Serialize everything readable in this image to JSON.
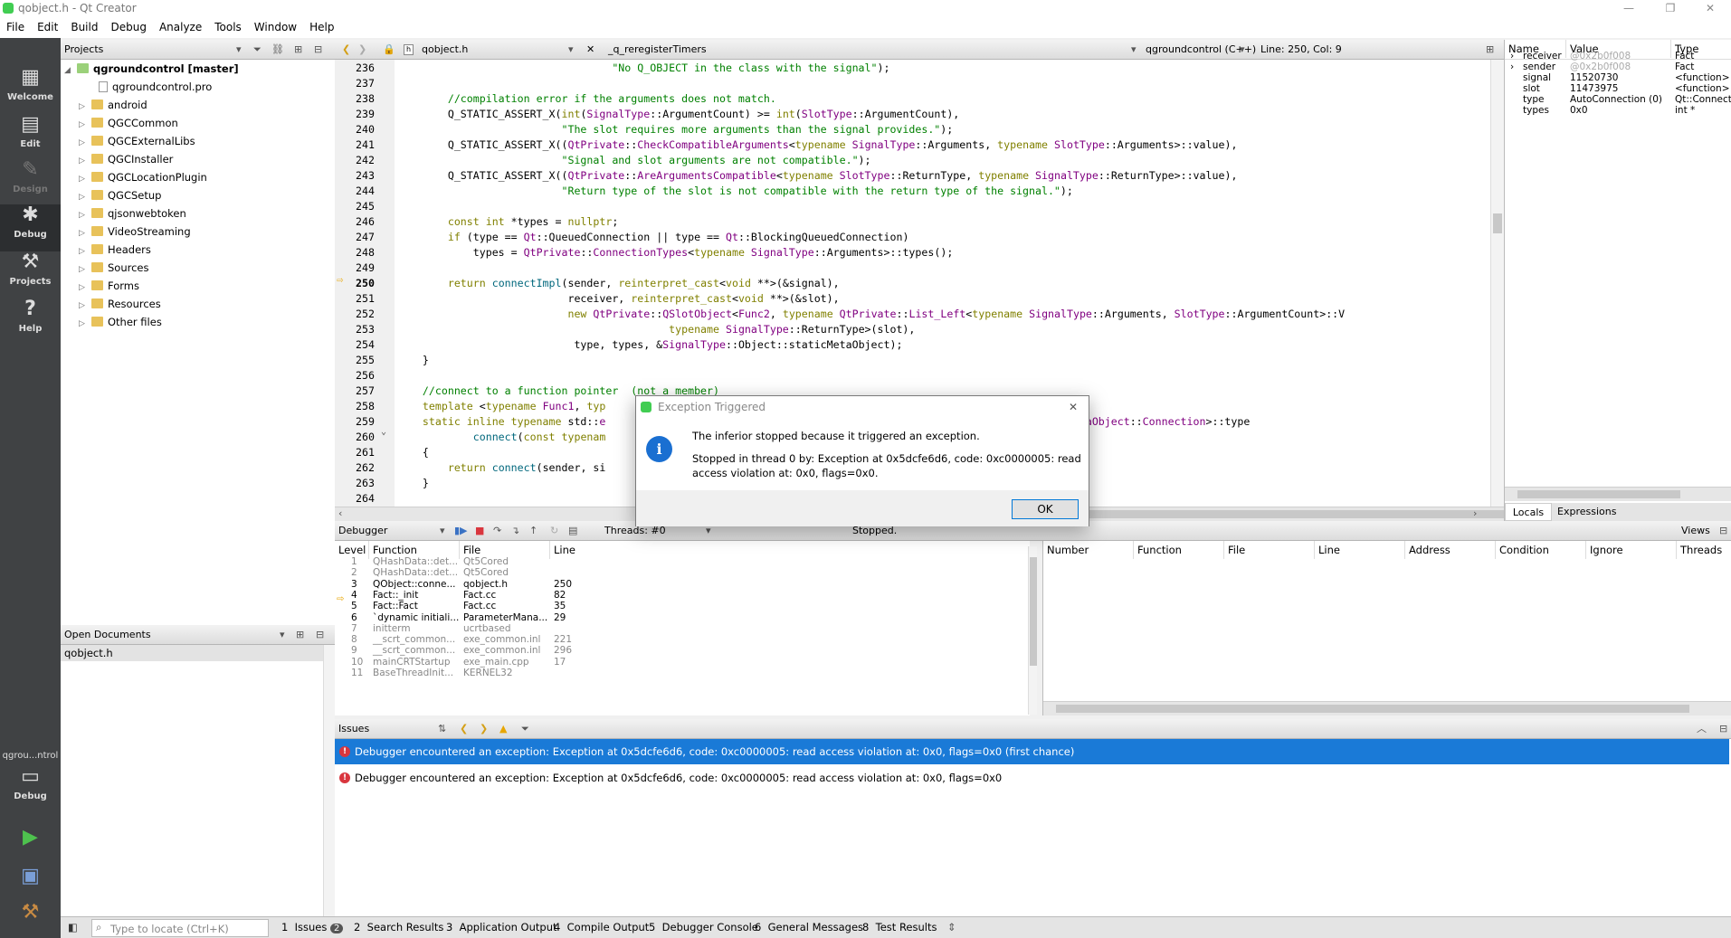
{
  "window": {
    "title": "qobject.h - Qt Creator",
    "minimize": "—",
    "restore": "❐",
    "close": "✕"
  },
  "menu": [
    "File",
    "Edit",
    "Build",
    "Debug",
    "Analyze",
    "Tools",
    "Window",
    "Help"
  ],
  "modes": [
    {
      "label": "Welcome",
      "icon": "grid-icon"
    },
    {
      "label": "Edit",
      "icon": "edit-icon"
    },
    {
      "label": "Design",
      "icon": "pen-icon"
    },
    {
      "label": "Debug",
      "icon": "bug-icon"
    },
    {
      "label": "Projects",
      "icon": "wrench-icon"
    },
    {
      "label": "Help",
      "icon": "help-icon"
    }
  ],
  "kit": {
    "label": "qgrou...ntrol",
    "mode": "Debug"
  },
  "projects": {
    "header": "Projects",
    "root": "qgroundcontrol [master]",
    "items": [
      "qgroundcontrol.pro",
      "android",
      "QGCCommon",
      "QGCExternalLibs",
      "QGCInstaller",
      "QGCLocationPlugin",
      "QGCSetup",
      "qjsonwebtoken",
      "VideoStreaming",
      "Headers",
      "Sources",
      "Forms",
      "Resources",
      "Other files"
    ]
  },
  "open_documents": {
    "header": "Open Documents",
    "items": [
      "qobject.h"
    ]
  },
  "editor_toolbar": {
    "file": "qobject.h",
    "symbol": "_q_reregisterTimers",
    "project": "qgroundcontrol (C++)",
    "position": "Line: 250, Col: 9"
  },
  "code": {
    "lines": [
      {
        "n": "236",
        "html": "                                  <span class='s'>\"No Q_OBJECT in the class with the signal\"</span>);"
      },
      {
        "n": "237",
        "html": ""
      },
      {
        "n": "238",
        "html": "        <span class='c'>//compilation error if the arguments does not match.</span>"
      },
      {
        "n": "239",
        "html": "        Q_STATIC_ASSERT_X(<span class='k'>int</span>(<span class='t'>SignalType</span>::ArgumentCount) &gt;= <span class='k'>int</span>(<span class='t'>SlotType</span>::ArgumentCount),"
      },
      {
        "n": "240",
        "html": "                          <span class='s'>\"The slot requires more arguments than the signal provides.\"</span>);"
      },
      {
        "n": "241",
        "html": "        Q_STATIC_ASSERT_X((<span class='t'>QtPrivate</span>::<span class='t'>CheckCompatibleArguments</span>&lt;<span class='k'>typename</span> <span class='t'>SignalType</span>::Arguments, <span class='k'>typename</span> <span class='t'>SlotType</span>::Arguments&gt;::value),"
      },
      {
        "n": "242",
        "html": "                          <span class='s'>\"Signal and slot arguments are not compatible.\"</span>);"
      },
      {
        "n": "243",
        "html": "        Q_STATIC_ASSERT_X((<span class='t'>QtPrivate</span>::<span class='t'>AreArgumentsCompatible</span>&lt;<span class='k'>typename</span> <span class='t'>SlotType</span>::ReturnType, <span class='k'>typename</span> <span class='t'>SignalType</span>::ReturnType&gt;::value),"
      },
      {
        "n": "244",
        "html": "                          <span class='s'>\"Return type of the slot is not compatible with the return type of the signal.\"</span>);"
      },
      {
        "n": "245",
        "html": ""
      },
      {
        "n": "246",
        "html": "        <span class='k'>const int</span> *types = <span class='k'>nullptr</span>;"
      },
      {
        "n": "247",
        "html": "        <span class='k'>if</span> (type == <span class='t'>Qt</span>::QueuedConnection || type == <span class='t'>Qt</span>::BlockingQueuedConnection)"
      },
      {
        "n": "248",
        "html": "            types = <span class='t'>QtPrivate</span>::<span class='t'>ConnectionTypes</span>&lt;<span class='k'>typename</span> <span class='t'>SignalType</span>::Arguments&gt;::types();"
      },
      {
        "n": "249",
        "html": ""
      },
      {
        "n": "250",
        "html": "        <span class='k'>return</span> <span class='f'>connectImpl</span>(sender, <span class='k'>reinterpret_cast</span>&lt;<span class='k'>void</span> **&gt;(&amp;signal),"
      },
      {
        "n": "251",
        "html": "                           receiver, <span class='k'>reinterpret_cast</span>&lt;<span class='k'>void</span> **&gt;(&amp;slot),"
      },
      {
        "n": "252",
        "html": "                           <span class='k'>new</span> <span class='t'>QtPrivate</span>::<span class='t'>QSlotObject</span>&lt;<span class='t'>Func2</span>, <span class='k'>typename</span> <span class='t'>QtPrivate</span>::<span class='t'>List_Left</span>&lt;<span class='k'>typename</span> <span class='t'>SignalType</span>::Arguments, <span class='t'>SlotType</span>::ArgumentCount&gt;::V"
      },
      {
        "n": "253",
        "html": "                                           <span class='k'>typename</span> <span class='t'>SignalType</span>::ReturnType&gt;(slot),"
      },
      {
        "n": "254",
        "html": "                            type, types, &amp;<span class='t'>SignalType</span>::Object::staticMetaObject);"
      },
      {
        "n": "255",
        "html": "    }"
      },
      {
        "n": "256",
        "html": ""
      },
      {
        "n": "257",
        "html": "    <span class='c'>//connect to a function pointer  (not a member)</span>"
      },
      {
        "n": "258",
        "html": "    <span class='k'>template</span> &lt;<span class='k'>typename</span> <span class='t'>Func1</span>, <span class='k'>typ</span>"
      },
      {
        "n": "259",
        "html": "    <span class='k'>static inline typename</span> std::<span class='t'>e</span>                                                                  &gt;= 0, <span class='t'>QMetaObject</span>::<span class='t'>Connection</span>&gt;::type"
      },
      {
        "n": "260",
        "html": "            <span class='f'>connect</span>(<span class='k'>const typenam</span>                                                            <span class='t'>nal</span>, <span class='t'>Func2</span> slot)"
      },
      {
        "n": "261",
        "html": "    {"
      },
      {
        "n": "262",
        "html": "        <span class='k'>return</span> <span class='f'>connect</span>(sender, si"
      },
      {
        "n": "263",
        "html": "    }"
      },
      {
        "n": "264",
        "html": ""
      }
    ]
  },
  "locals": {
    "headers": [
      "Name",
      "Value",
      "Type"
    ],
    "rows": [
      {
        "name": "receiver",
        "value": "@0x2b0f008",
        "type": "Fact",
        "exp": true,
        "dim": true
      },
      {
        "name": "sender",
        "value": "@0x2b0f008",
        "type": "Fact",
        "exp": true,
        "dim": true
      },
      {
        "name": "signal",
        "value": "11520730",
        "type": "<function>",
        "exp": false,
        "dim": false
      },
      {
        "name": "slot",
        "value": "11473975",
        "type": "<function>",
        "exp": false,
        "dim": false
      },
      {
        "name": "type",
        "value": "AutoConnection (0)",
        "type": "Qt::Connect",
        "exp": false,
        "dim": false
      },
      {
        "name": "types",
        "value": "0x0",
        "type": "int *",
        "exp": false,
        "dim": false
      }
    ],
    "tabs": [
      "Locals",
      "Expressions"
    ]
  },
  "debugger": {
    "combo": "Debugger",
    "threads": "Threads: #0",
    "status": "Stopped.",
    "views": "Views",
    "stack_headers": [
      "Level",
      "Function",
      "File",
      "Line"
    ],
    "stack": [
      {
        "level": "1",
        "func": "QHashData::det...",
        "file": "Qt5Cored",
        "line": "",
        "dim": true
      },
      {
        "level": "2",
        "func": "QHashData::det...",
        "file": "Qt5Cored",
        "line": "",
        "dim": true
      },
      {
        "level": "3",
        "func": "QObject::conne...",
        "file": "qobject.h",
        "line": "250",
        "dim": false
      },
      {
        "level": "4",
        "func": "Fact::_init",
        "file": "Fact.cc",
        "line": "82",
        "dim": false
      },
      {
        "level": "5",
        "func": "Fact::Fact",
        "file": "Fact.cc",
        "line": "35",
        "dim": false
      },
      {
        "level": "6",
        "func": "`dynamic initiali...",
        "file": "ParameterMana...",
        "line": "29",
        "dim": false
      },
      {
        "level": "7",
        "func": "initterm",
        "file": "ucrtbased",
        "line": "",
        "dim": true
      },
      {
        "level": "8",
        "func": "__scrt_common...",
        "file": "exe_common.inl",
        "line": "221",
        "dim": true
      },
      {
        "level": "9",
        "func": "__scrt_common...",
        "file": "exe_common.inl",
        "line": "296",
        "dim": true
      },
      {
        "level": "10",
        "func": "mainCRTStartup",
        "file": "exe_main.cpp",
        "line": "17",
        "dim": true
      },
      {
        "level": "11",
        "func": "BaseThreadInit...",
        "file": "KERNEL32",
        "line": "",
        "dim": true
      }
    ],
    "bp_headers": [
      "Number",
      "Function",
      "File",
      "Line",
      "Address",
      "Condition",
      "Ignore",
      "Threads"
    ]
  },
  "issues": {
    "header": "Issues",
    "items": [
      "Debugger encountered an exception: Exception at 0x5dcfe6d6, code: 0xc0000005: read access violation at: 0x0, flags=0x0 (first chance)",
      "Debugger encountered an exception: Exception at 0x5dcfe6d6, code: 0xc0000005: read access violation at: 0x0, flags=0x0"
    ]
  },
  "bottom": {
    "locator_placeholder": "Type to locate (Ctrl+K)",
    "tabs": [
      {
        "num": "1",
        "label": "Issues",
        "badge": "2"
      },
      {
        "num": "2",
        "label": "Search Results"
      },
      {
        "num": "3",
        "label": "Application Output"
      },
      {
        "num": "4",
        "label": "Compile Output"
      },
      {
        "num": "5",
        "label": "Debugger Console"
      },
      {
        "num": "6",
        "label": "General Messages"
      },
      {
        "num": "8",
        "label": "Test Results"
      }
    ]
  },
  "dialog": {
    "title": "Exception Triggered",
    "message": "The inferior stopped because it triggered an exception.",
    "detail": "Stopped in thread 0 by: Exception at 0x5dcfe6d6, code: 0xc0000005: read access violation at: 0x0, flags=0x0.",
    "ok": "OK"
  },
  "colors": {
    "sidebar": "#404244",
    "selection": "#1a7ad7",
    "accent": "#41cd52",
    "error": "#d9363e"
  }
}
